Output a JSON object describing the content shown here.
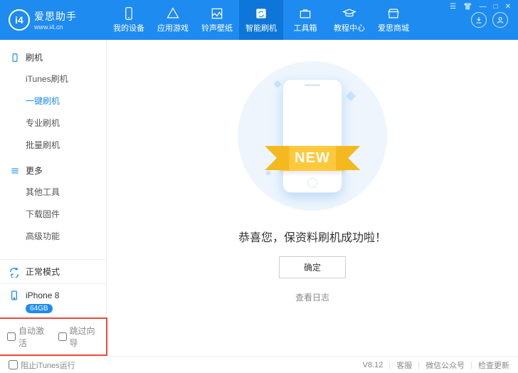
{
  "brand": {
    "logo_text": "i4",
    "name_cn": "爱思助手",
    "name_en": "www.i4.cn"
  },
  "nav": [
    {
      "label": "我的设备"
    },
    {
      "label": "应用游戏"
    },
    {
      "label": "铃声壁纸"
    },
    {
      "label": "智能刷机"
    },
    {
      "label": "工具箱"
    },
    {
      "label": "教程中心"
    },
    {
      "label": "爱思商城"
    }
  ],
  "sidebar": {
    "section1": {
      "title": "刷机",
      "items": [
        "iTunes刷机",
        "一键刷机",
        "专业刷机",
        "批量刷机"
      ]
    },
    "section2": {
      "title": "更多",
      "items": [
        "其他工具",
        "下载固件",
        "高级功能"
      ]
    },
    "mode": "正常模式",
    "device_name": "iPhone 8",
    "device_badge": "64GB",
    "options": {
      "auto_activate": "自动激活",
      "skip_guide": "跳过向导"
    }
  },
  "main": {
    "ribbon": "NEW",
    "success": "恭喜您，保资料刷机成功啦！",
    "ok": "确定",
    "view_log": "查看日志"
  },
  "footer": {
    "block_itunes": "阻止iTunes运行",
    "version": "V8.12",
    "support": "客服",
    "wechat": "微信公众号",
    "update": "检查更新"
  }
}
